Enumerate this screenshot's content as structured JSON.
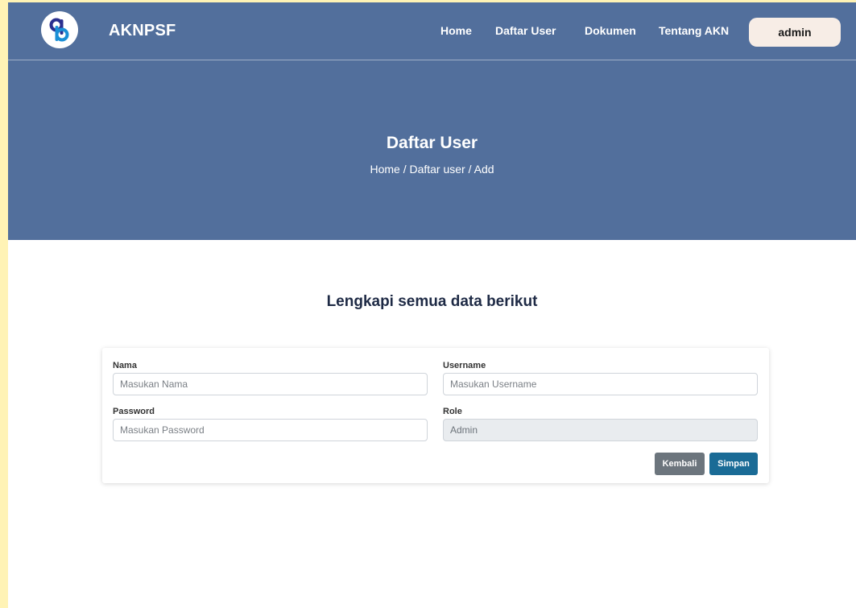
{
  "navbar": {
    "brand": "AKNPSF",
    "logo_icon": "logo-icon",
    "items": [
      {
        "label": "Home"
      },
      {
        "label": "Daftar User"
      },
      {
        "label": "Dokumen"
      },
      {
        "label": "Tentang AKN"
      }
    ],
    "user_button": "admin"
  },
  "hero": {
    "title": "Daftar User",
    "breadcrumb": "Home / Daftar user / Add"
  },
  "form": {
    "heading": "Lengkapi semua data berikut",
    "nama": {
      "label": "Nama",
      "placeholder": "Masukan Nama"
    },
    "username": {
      "label": "Username",
      "placeholder": "Masukan Username"
    },
    "password": {
      "label": "Password",
      "placeholder": "Masukan Password"
    },
    "role": {
      "label": "Role",
      "value": "Admin"
    },
    "back_button": "Kembali",
    "save_button": "Simpan"
  },
  "colors": {
    "hero_bg": "#526f9c",
    "save_button": "#1a6b96",
    "back_button": "#6c757d",
    "outer_bg": "#fff3b5"
  }
}
